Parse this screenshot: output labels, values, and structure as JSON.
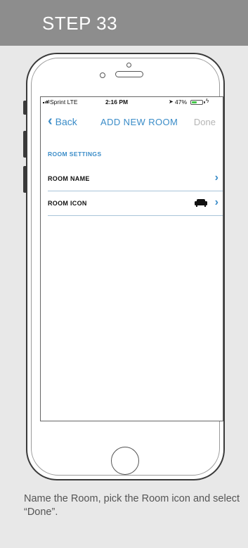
{
  "banner": {
    "step_title": "STEP 33"
  },
  "status_bar": {
    "carrier": "Sprint  LTE",
    "time": "2:16 PM",
    "battery_percent": "47%",
    "battery_level": 0.47
  },
  "nav": {
    "back_label": "Back",
    "title": "ADD NEW ROOM",
    "done_label": "Done"
  },
  "section": {
    "header": "ROOM SETTINGS"
  },
  "rows": [
    {
      "label": "ROOM NAME"
    },
    {
      "label": "ROOM ICON",
      "icon": "sofa-icon"
    }
  ],
  "caption": "Name the Room, pick the Room icon and select “Done”.",
  "colors": {
    "accent": "#3a8cc8",
    "banner": "#8d8d8d",
    "page_bg": "#e8e8e8",
    "battery_green": "#44c84a"
  }
}
